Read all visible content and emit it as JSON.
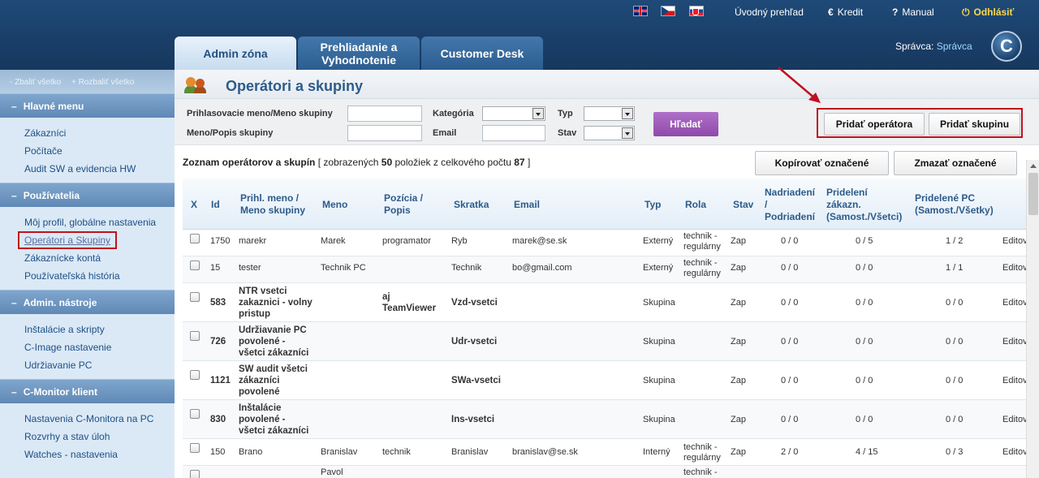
{
  "header": {
    "links": {
      "overview": "Úvodný prehľad",
      "credit": "Kredit",
      "manual": "Manual",
      "logout": "Odhlásiť"
    },
    "flags": [
      "english-flag",
      "czech-flag",
      "slovak-flag"
    ],
    "tabs": [
      {
        "label": "Admin zóna"
      },
      {
        "label": "Prehliadanie a Vyhodnotenie"
      },
      {
        "label": "Customer Desk"
      }
    ],
    "admin_prefix": "Správca:",
    "admin_name": "Správca",
    "logo_letter": "C"
  },
  "sidebar": {
    "collapse_all": "- Zbaliť všetko",
    "expand_all": "+ Rozbaliť všetko",
    "sections": [
      {
        "title": "Hlavné menu",
        "items": [
          "Zákazníci",
          "Počítače",
          "Audit SW a evidencia HW"
        ]
      },
      {
        "title": "Používatelia",
        "items": [
          "Môj profil, globálne nastavenia",
          "Operátori a Skupiny",
          "Zákaznícke kontá",
          "Používateľská história"
        ]
      },
      {
        "title": "Admin. nástroje",
        "items": [
          "Inštalácie a skripty",
          "C-Image nastavenie",
          "Udržiavanie PC"
        ]
      },
      {
        "title": "C-Monitor klient",
        "items": [
          "Nastavenia C-Monitora na PC",
          "Rozvrhy a stav úloh",
          "Watches - nastavenia"
        ]
      }
    ],
    "active_item": "Operátori a Skupiny"
  },
  "page": {
    "title": "Operátori a skupiny"
  },
  "filter": {
    "login_label": "Prihlasovacie meno/Meno skupiny",
    "name_label": "Meno/Popis skupiny",
    "category_label": "Kategória",
    "email_label": "Email",
    "type_label": "Typ",
    "state_label": "Stav",
    "search_button": "Hľadať",
    "add_operator_button": "Pridať operátora",
    "add_group_button": "Pridať skupinu"
  },
  "list": {
    "title": "Zoznam operátorov a skupín",
    "shown_prefix": "[ zobrazených",
    "shown_count": "50",
    "shown_middle": "položiek z celkového počtu",
    "total_count": "87",
    "shown_suffix": "]",
    "copy_button": "Kopírovať označené",
    "delete_button": "Zmazať označené"
  },
  "table": {
    "headers": {
      "x": "X",
      "id": "Id",
      "login_1": "Prihl. meno /",
      "login_2": "Meno skupiny",
      "name": "Meno",
      "position_1": "Pozícia /",
      "position_2": "Popis",
      "abbr": "Skratka",
      "email": "Email",
      "type": "Typ",
      "role": "Rola",
      "state": "Stav",
      "parent_1": "Nadriadení",
      "parent_2": "/",
      "parent_3": "Podriadení",
      "customers_1": "Pridelení",
      "customers_2": "zákazn.",
      "customers_3": "(Samost./Všetci)",
      "pcs_1": "Pridelené PC",
      "pcs_2": "(Samost./Všetky)"
    },
    "rows": [
      {
        "id": "1750",
        "login": [
          "marekr"
        ],
        "name": "Marek",
        "position": [
          "programator"
        ],
        "abbr": "Ryb",
        "email": "marek@se.sk",
        "type": "Externý",
        "role": [
          "technik -",
          "regulárny"
        ],
        "state": "Zap",
        "parents": "0 / 0",
        "customers": "0 / 5",
        "pcs": "1 / 2",
        "action": "Editovať",
        "group": false
      },
      {
        "id": "15",
        "login": [
          "tester"
        ],
        "name": "Technik PC",
        "position": [
          ""
        ],
        "abbr": "Technik",
        "email": "bo@gmail.com",
        "type": "Externý",
        "role": [
          "technik -",
          "regulárny"
        ],
        "state": "Zap",
        "parents": "0 / 0",
        "customers": "0 / 0",
        "pcs": "1 / 1",
        "action": "Editovať",
        "group": false
      },
      {
        "id": "583",
        "login": [
          "NTR vsetci",
          "zakaznici - volny",
          "pristup"
        ],
        "name": "",
        "position": [
          "aj",
          "TeamViewer"
        ],
        "abbr": "Vzd-vsetci",
        "email": "",
        "type": "Skupina",
        "role": [
          ""
        ],
        "state": "Zap",
        "parents": "0 / 0",
        "customers": "0 / 0",
        "pcs": "0 / 0",
        "action": "Editovať",
        "group": true
      },
      {
        "id": "726",
        "login": [
          "Udržiavanie PC",
          "povolené -",
          "všetci zákazníci"
        ],
        "name": "",
        "position": [
          ""
        ],
        "abbr": "Udr-vsetci",
        "email": "",
        "type": "Skupina",
        "role": [
          ""
        ],
        "state": "Zap",
        "parents": "0 / 0",
        "customers": "0 / 0",
        "pcs": "0 / 0",
        "action": "Editovať",
        "group": true
      },
      {
        "id": "1121",
        "login": [
          "SW audit všetci",
          "zákazníci",
          "povolené"
        ],
        "name": "",
        "position": [
          ""
        ],
        "abbr": "SWa-vsetci",
        "email": "",
        "type": "Skupina",
        "role": [
          ""
        ],
        "state": "Zap",
        "parents": "0 / 0",
        "customers": "0 / 0",
        "pcs": "0 / 0",
        "action": "Editovať",
        "group": true
      },
      {
        "id": "830",
        "login": [
          "Inštalácie",
          "povolené -",
          "všetci zákazníci"
        ],
        "name": "",
        "position": [
          ""
        ],
        "abbr": "Ins-vsetci",
        "email": "",
        "type": "Skupina",
        "role": [
          ""
        ],
        "state": "Zap",
        "parents": "0 / 0",
        "customers": "0 / 0",
        "pcs": "0 / 0",
        "action": "Editovať",
        "group": true
      },
      {
        "id": "150",
        "login": [
          "Brano"
        ],
        "name": "Branislav",
        "position": [
          "technik"
        ],
        "abbr": "Branislav",
        "email": "branislav@se.sk",
        "type": "Interný",
        "role": [
          "technik -",
          "regulárny"
        ],
        "state": "Zap",
        "parents": "2 / 0",
        "customers": "4 / 15",
        "pcs": "0 / 3",
        "action": "Editovať",
        "group": false
      },
      {
        "id": "",
        "login": [
          ""
        ],
        "name": "Pavol",
        "position": [
          ""
        ],
        "abbr": "",
        "email": "",
        "type": "",
        "role": [
          "technik -"
        ],
        "state": "",
        "parents": "",
        "customers": "",
        "pcs": "",
        "action": "",
        "group": false
      }
    ]
  },
  "colors": {
    "header_bg": "#1a3f69",
    "link_blue": "#1d4f84",
    "title_blue": "#2d5b8a",
    "highlight_red": "#c0111f",
    "search_purple": "#9a55b4",
    "logout_yellow": "#ffd84a"
  }
}
